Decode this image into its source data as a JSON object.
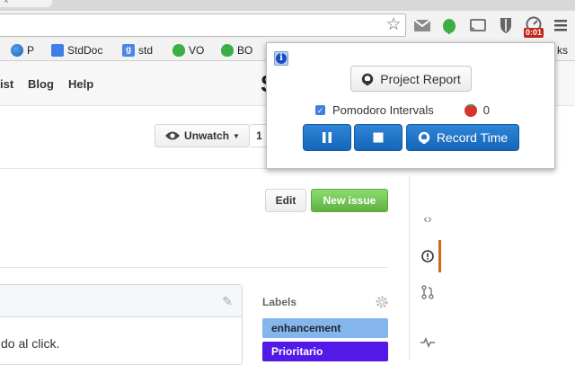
{
  "browser": {
    "tab_close": "×",
    "timer_badge": "0:01",
    "bookmarks": [
      {
        "label": "P",
        "icon": "globe-icon"
      },
      {
        "label": "StdDoc",
        "icon": "docs-icon"
      },
      {
        "label": "std",
        "icon": "google-icon"
      },
      {
        "label": "VO",
        "icon": "evernote-icon"
      },
      {
        "label": "BO",
        "icon": "evernote-icon"
      },
      {
        "label": "ks",
        "icon": "folder-icon"
      }
    ]
  },
  "nav": {
    "links": [
      "ist",
      "Blog",
      "Help"
    ],
    "logo_fragment": "S"
  },
  "repo": {
    "unwatch_label": "Unwatch",
    "watch_count": "1"
  },
  "issues": {
    "edit_label": "Edit",
    "new_issue_label": "New issue"
  },
  "comment": {
    "text": "do al click."
  },
  "labels": {
    "heading": "Labels",
    "items": [
      {
        "name": "enhancement",
        "color": "#84b6eb"
      },
      {
        "name": "Prioritario",
        "color": "#5319e7"
      }
    ]
  },
  "popup": {
    "info_glyph": "i",
    "project_report_label": "Project Report",
    "pomodoro_label": "Pomodoro Intervals",
    "pomodoro_count": "0",
    "record_time_label": "Record Time"
  },
  "colors": {
    "accent_blue": "#1f77c9",
    "new_issue_green": "#6cc644",
    "tomato": "#d9342b"
  }
}
